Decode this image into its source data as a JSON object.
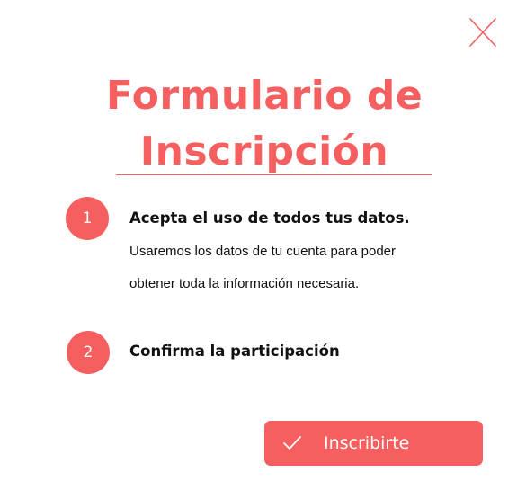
{
  "colors": {
    "accent": "#f55f5f",
    "text": "#111111",
    "background": "#ffffff"
  },
  "dialog": {
    "close_icon": "close-icon",
    "title_line1": "Formulario de",
    "title_line2": "Inscripción"
  },
  "steps": [
    {
      "number": "1",
      "title": "Acepta el uso de todos tus datos.",
      "description": "Usaremos los datos de tu cuenta para poder obtener toda la información necesaria."
    },
    {
      "number": "2",
      "title": "Confirma la participación"
    }
  ],
  "submit": {
    "icon": "check-icon",
    "label": "Inscribirte"
  }
}
